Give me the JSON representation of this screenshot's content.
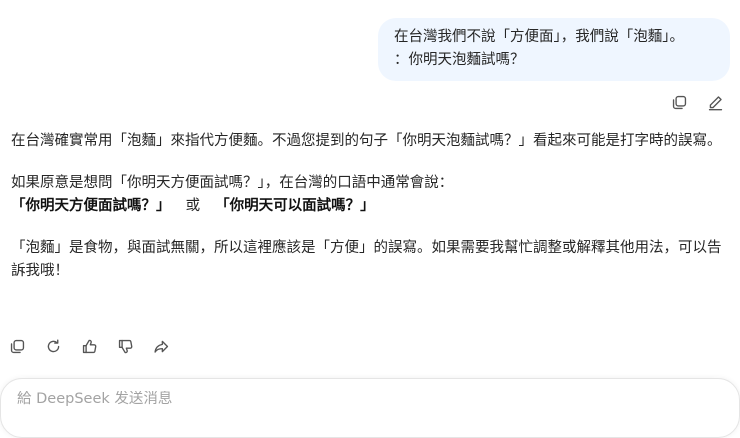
{
  "user_message": {
    "line1": "在台灣我們不說「方便面」，我們說「泡麵」。",
    "line2": "：你明天泡麵試嗎？"
  },
  "user_message_actions": [
    {
      "icon": "copy-icon"
    },
    {
      "icon": "edit-icon"
    }
  ],
  "assistant_message": {
    "paragraph1": "在台灣確實常用「泡麵」來指代方便麵。不過您提到的句子「你明天泡麵試嗎？」看起來可能是打字時的誤寫。",
    "paragraph2_intro": "如果原意是想問「你明天方便面試嗎？」，在台灣的口語中通常會說：",
    "option1": "「你明天方便面試嗎？」",
    "separator": "或",
    "option2": "「你明天可以面試嗎？」",
    "paragraph3": "「泡麵」是食物，與面試無關，所以這裡應該是「方便」的誤寫。如果需要我幫忙調整或解釋其他用法，可以告訴我哦！"
  },
  "assistant_actions": [
    {
      "icon": "copy-icon"
    },
    {
      "icon": "regenerate-icon"
    },
    {
      "icon": "thumbs-up-icon"
    },
    {
      "icon": "thumbs-down-icon"
    },
    {
      "icon": "share-icon"
    }
  ],
  "composer": {
    "placeholder": "給 DeepSeek 发送消息"
  },
  "colors": {
    "user_bubble_bg": "#eff6ff",
    "text": "#262626",
    "icon": "#555555",
    "placeholder": "#a3a3a3"
  }
}
